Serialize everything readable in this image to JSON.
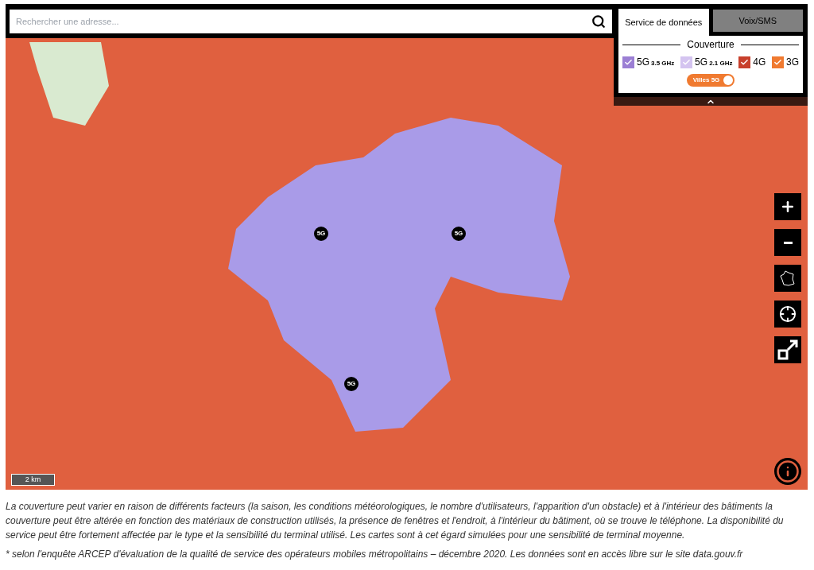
{
  "search": {
    "placeholder": "Rechercher une adresse..."
  },
  "tabs": [
    {
      "label": "Service de données",
      "selected": true
    },
    {
      "label": "Voix/SMS",
      "selected": false
    }
  ],
  "coverage": {
    "title": "Couverture",
    "layers": [
      {
        "label": "5G",
        "sublabel": "3.5 GHz",
        "checked": true,
        "color": "#9b7fd4"
      },
      {
        "label": "5G",
        "sublabel": "2.1 GHz",
        "checked": true,
        "color": "#d4c4f0"
      },
      {
        "label": "4G",
        "checked": true,
        "color": "#c8402c"
      },
      {
        "label": "3G",
        "checked": true,
        "color": "#f07a30"
      }
    ],
    "toggle": {
      "label": "Villes 5G",
      "on": true
    }
  },
  "map": {
    "markers": [
      "5G",
      "5G",
      "5G"
    ],
    "scale": "2 km"
  },
  "notes": [
    "La couverture peut varier en raison de différents facteurs (la saison, les conditions météorologiques, le nombre d'utilisateurs, l'apparition d'un obstacle) et à l'intérieur des bâtiments la couverture peut être altérée en fonction des matériaux de construction utilisés, la présence de fenêtres et l'endroit, à l'intérieur du bâtiment, où se trouve le téléphone. La disponibilité du service peut être fortement affectée par le type et la sensibilité du terminal utilisé. Les cartes sont à cet égard simulées pour une sensibilité de terminal moyenne.",
    "* selon l'enquête ARCEP d'évaluation de la qualité de service des opérateurs mobiles métropolitains – décembre 2020. Les données sont en accès libre sur le site data.gouv.fr"
  ]
}
